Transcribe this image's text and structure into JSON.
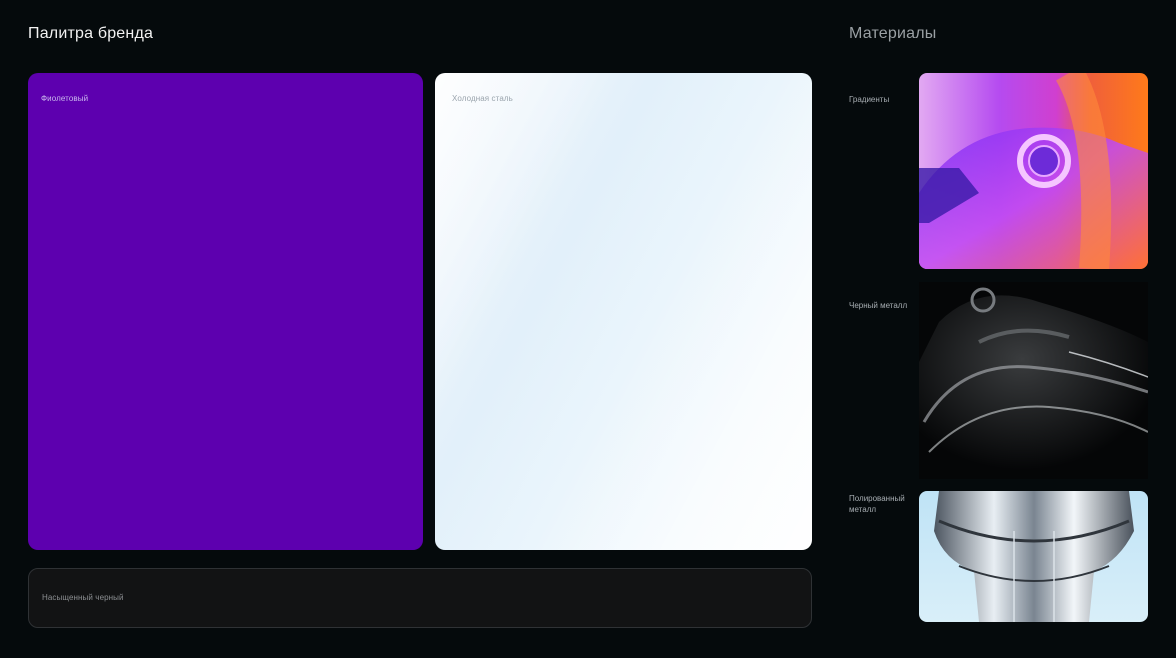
{
  "brand": {
    "title": "Палитра бренда",
    "swatches": {
      "violet": {
        "label": "Фиолетовый",
        "color": "#5d00af"
      },
      "cold_steel": {
        "label": "Холодная сталь",
        "color": "#e6f2fa"
      },
      "rich_black": {
        "label": "Насыщенный черный",
        "color": "#121314"
      }
    }
  },
  "materials": {
    "title": "Материалы",
    "items": [
      {
        "label": "Градиенты"
      },
      {
        "label": "Черный металл"
      },
      {
        "label": "Полированный металл"
      }
    ]
  }
}
